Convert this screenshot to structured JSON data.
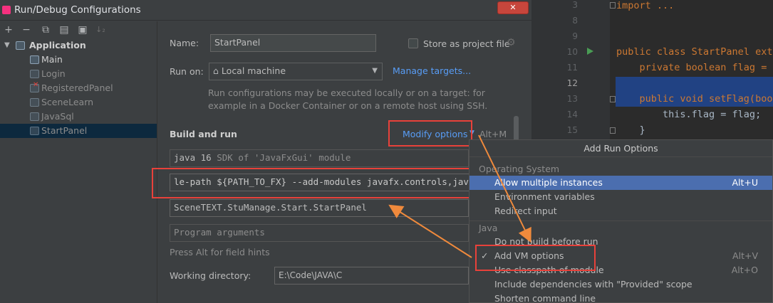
{
  "window": {
    "title": "Run/Debug Configurations"
  },
  "toolbar": {
    "add": "+",
    "remove": "−",
    "copy": "⧉",
    "save": "▤",
    "folder": "▣",
    "sort": "↓₂"
  },
  "tree": {
    "root": {
      "label": "Application"
    },
    "items": [
      {
        "label": "Main"
      },
      {
        "label": "Login"
      },
      {
        "label": "RegisteredPanel"
      },
      {
        "label": "SceneLearn"
      },
      {
        "label": "JavaSql"
      },
      {
        "label": "StartPanel"
      }
    ]
  },
  "form": {
    "name_label": "Name:",
    "name_value": "StartPanel",
    "store_label": "Store as project file",
    "runon_label": "Run on:",
    "runon_value": "Local machine",
    "manage_targets": "Manage targets...",
    "hint_line1": "Run configurations may be executed locally or on a target: for",
    "hint_line2": "example in a Docker Container or on a remote host using SSH.",
    "build_run_label": "Build and run",
    "modify_options": "Modify options",
    "modify_shortcut": "Alt+M",
    "sdk_java": "java 16",
    "sdk_rest": "SDK of 'JavaFxGui' module",
    "vm_options": "le-path ${PATH_TO_FX} --add-modules javafx.controls,javafx.",
    "main_class": "SceneTEXT.StuManage.Start.StartPanel",
    "program_args_placeholder": "Program arguments",
    "alt_hint": "Press Alt for field hints",
    "workdir_label": "Working directory:",
    "workdir_value": "E:\\Code\\JAVA\\C"
  },
  "editor": {
    "lines": [
      {
        "num": "3",
        "text": "import ..."
      },
      {
        "num": "8",
        "text": ""
      },
      {
        "num": "9",
        "text": ""
      },
      {
        "num": "10",
        "text": "public class StartPanel exte"
      },
      {
        "num": "11",
        "text": "    private boolean flag = t"
      },
      {
        "num": "12",
        "text": ""
      },
      {
        "num": "13",
        "text": "    public void setFlag(bool"
      },
      {
        "num": "14",
        "text": "        this.flag = flag;"
      },
      {
        "num": "15",
        "text": "    }"
      }
    ]
  },
  "popup": {
    "title": "Add Run Options",
    "section_os": "Operating System",
    "section_java": "Java",
    "items": [
      {
        "label": "Allow multiple instances",
        "shortcut": "Alt+U"
      },
      {
        "label": "Environment variables",
        "shortcut": ""
      },
      {
        "label": "Redirect input",
        "shortcut": ""
      },
      {
        "label": "Do not build before run",
        "shortcut": ""
      },
      {
        "label": "Add VM options",
        "shortcut": "Alt+V",
        "checked": "✓"
      },
      {
        "label": "Use classpath of module",
        "shortcut": "Alt+O"
      },
      {
        "label": "Include dependencies with \"Provided\" scope",
        "shortcut": ""
      },
      {
        "label": "Shorten command line",
        "shortcut": ""
      }
    ]
  },
  "colors": {
    "accent_link": "#589df6",
    "selection": "#4b6eaf",
    "annotation": "#e8413a",
    "arrow": "#f08a3c"
  }
}
